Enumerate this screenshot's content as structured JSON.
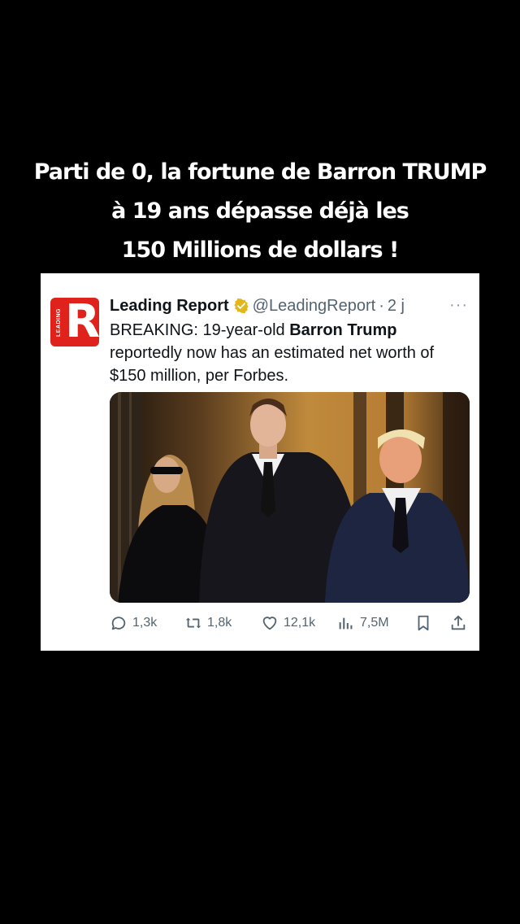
{
  "headline": {
    "line1": "Parti de 0, la fortune de Barron TRUMP",
    "line2": "à 19 ans dépasse déjà les",
    "line3": "150 Millions de dollars !"
  },
  "tweet": {
    "avatar_logo_letter": "R",
    "avatar_logo_word": "LEADING",
    "author_name": "Leading Report",
    "handle": "@LeadingReport",
    "separator": "·",
    "time": "2 j",
    "more": "···",
    "text_part1": "BREAKING: 19-year-old ",
    "text_bold": "Barron Trump",
    "text_part2": " reportedly now has an estimated net worth of $150 million, per Forbes.",
    "photo_icon": "photo-of-three-people",
    "actions": {
      "replies": "1,3k",
      "reposts": "1,8k",
      "likes": "12,1k",
      "views": "7,5M"
    },
    "verified_color": "#e2b719",
    "brand_color": "#e0221d"
  }
}
